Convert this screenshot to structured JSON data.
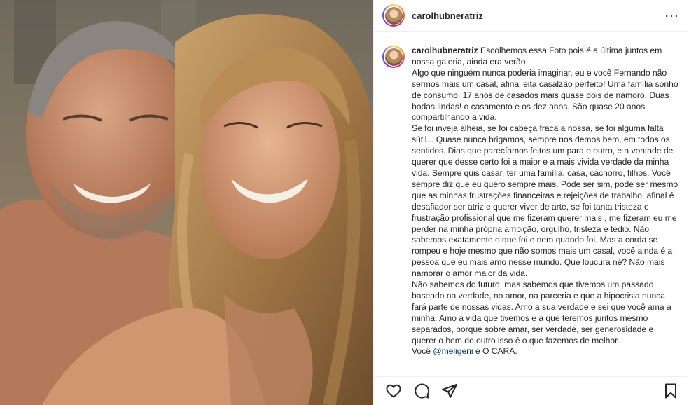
{
  "post": {
    "username": "carolhubneratriz",
    "more_label": "···"
  },
  "caption": {
    "username": "carolhubneratriz",
    "first_line": "Escolhemos essa Foto pois é a última juntos em nossa galeria, ainda era verão.",
    "paragraph_1": "Algo que ninguém nunca poderia imaginar, eu e você Fernando não sermos mais um casal, afinal eita casalzão perfeito! Uma família sonho de consumo. 17 anos de casados mais quase dois de namoro. Duas bodas lindas! o casamento e os dez anos. São quase 20 anos compartilhando a vida.",
    "paragraph_2": "Se foi inveja alheia, se foi cabeça fraca a nossa, se foi alguma falta sútil... Quase nunca brigamos, sempre nos demos bem, em todos os sentidos. Dias que parecíamos feitos um para o outro, e a vontade de querer que desse certo foi a maior e a mais vivida verdade da minha vida. Sempre quis casar, ter uma família, casa, cachorro, filhos. Você sempre diz que eu quero sempre mais. Pode ser sim, pode ser mesmo que as minhas frustrações financeiras e rejeições de trabalho, afinal é desafiador ser atriz e querer viver de arte, se foi tanta tristeza e frustração profissional que me fizeram querer mais , me fizeram eu me perder na minha própria ambição, orgulho, tristeza e tédio. Não sabemos exatamente o que foi e nem quando foi. Mas a corda se rompeu e hoje mesmo que não somos mais um casal, você ainda é a pessoa que eu mais amo nesse mundo. Que loucura né? Não mais namorar o amor maior da vida.",
    "paragraph_3": "Não sabemos do futuro, mas sabemos que tivemos um passado baseado na verdade, no amor, na parceria e que a hipocrisia nunca fará parte de nossas vidas. Amo a sua verdade e sei que você ama a minha. Amo a vida que tivemos e a que teremos juntos mesmo separados, porque sobre amar, ser verdade, ser generosidade e querer o bem do outro isso é o que fazemos de melhor.",
    "last_prefix": "Você ",
    "mention": "@meligeni",
    "last_suffix": " é O CARA."
  },
  "actions": {
    "icons": [
      "heart-icon",
      "comment-icon",
      "share-icon",
      "bookmark-icon"
    ]
  },
  "colors": {
    "text": "#262626",
    "mention": "#00376b",
    "divider": "#efefef"
  }
}
